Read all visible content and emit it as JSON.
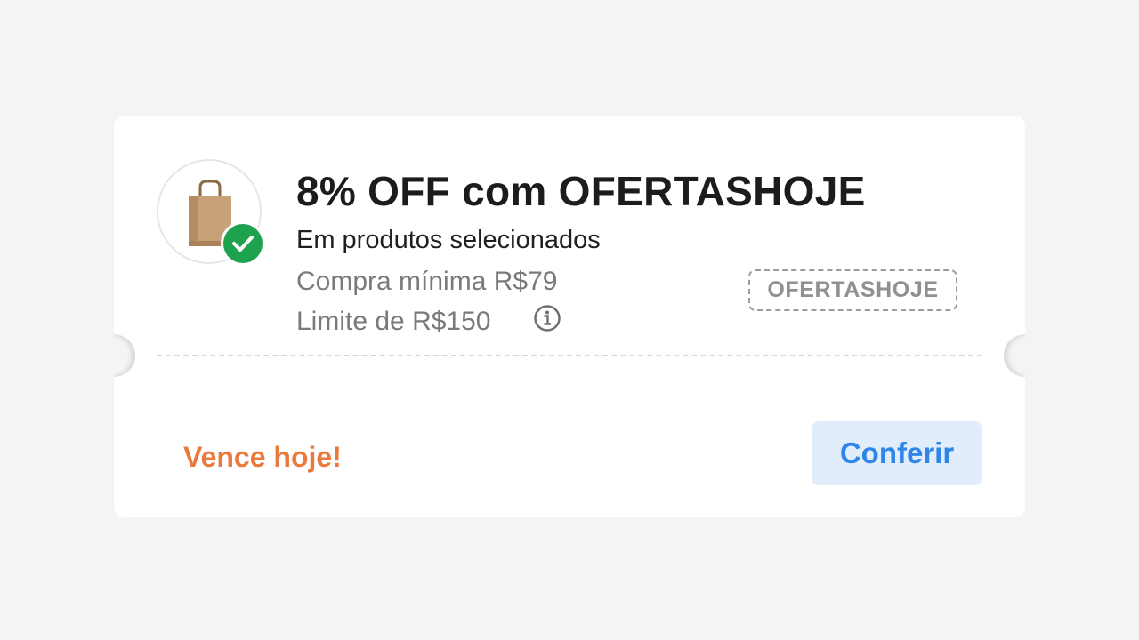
{
  "coupon": {
    "title": "8% OFF com OFERTASHOJE",
    "subtitle": "Em produtos selecionados",
    "min_purchase": "Compra mínima R$79",
    "limit": "Limite de R$150",
    "code": "OFERTASHOJE",
    "expiry": "Vence hoje!",
    "cta_label": "Conferir",
    "icons": {
      "product": "shopping-bag-icon",
      "status": "check-icon",
      "info": "info-icon"
    },
    "colors": {
      "check": "#1fa24d",
      "expiry": "#ea7a3c",
      "cta_text": "#2f86e8",
      "cta_bg": "#e2edfc"
    }
  }
}
